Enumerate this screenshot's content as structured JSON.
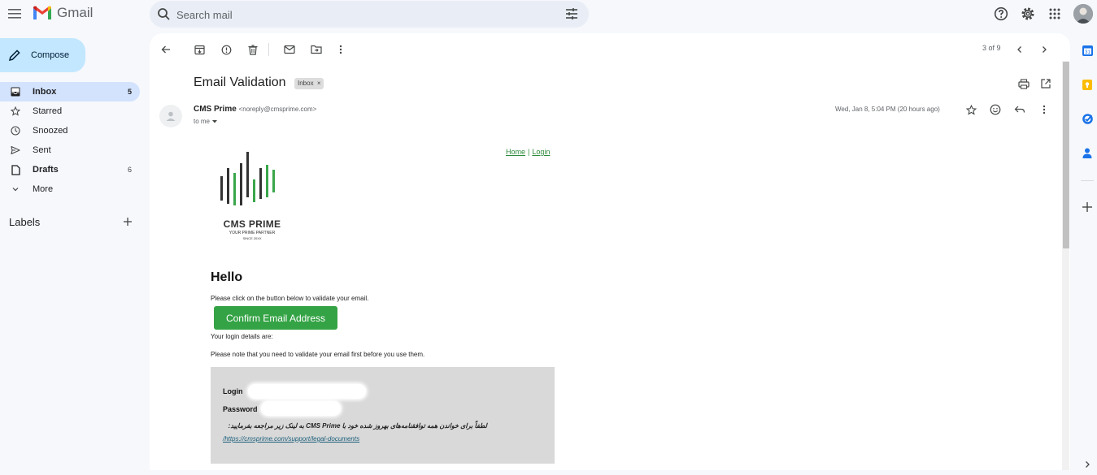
{
  "app": {
    "brand": "Gmail"
  },
  "search": {
    "placeholder": "Search mail"
  },
  "nav": {
    "compose_label": "Compose",
    "items": [
      {
        "label": "Inbox",
        "count": "5",
        "icon": "inbox-icon",
        "active": true
      },
      {
        "label": "Starred",
        "count": "",
        "icon": "star-icon"
      },
      {
        "label": "Snoozed",
        "count": "",
        "icon": "clock-icon"
      },
      {
        "label": "Sent",
        "count": "",
        "icon": "send-icon"
      },
      {
        "label": "Drafts",
        "count": "6",
        "icon": "draft-icon",
        "bold": true
      },
      {
        "label": "More",
        "count": "",
        "icon": "chevron-down-icon"
      }
    ],
    "labels_title": "Labels"
  },
  "toolbar": {
    "pager": "3 of 9"
  },
  "email": {
    "subject": "Email Validation",
    "tag": "Inbox",
    "sender_name": "CMS Prime",
    "sender_addr": "<noreply@cmsprime.com>",
    "to": "to me",
    "date": "Wed, Jan 8, 5:04 PM (20 hours ago)"
  },
  "body": {
    "nav_home": "Home",
    "nav_sep": "|",
    "nav_login": "Login",
    "logo_text": "CMS PRIME",
    "logo_tagline": "YOUR PRIME PARTNER",
    "logo_since": "SINCE 20XX",
    "hello": "Hello",
    "instruction": "Please click on the button below to validate your email.",
    "button": "Confirm Email Address",
    "login_details": "Your login details are:",
    "note": "Please note that you need to validate your email first before you use them.",
    "login_label": "Login",
    "password_label": "Password",
    "farsi_text": "لطفاً برای خواندن همه توافقنامه‌های بهروز شده خود با CMS Prime به لینک زیر مراجعه بفرمایید:",
    "legal_link": "/https://cmsprime.com/support/legal-documents"
  },
  "colors": {
    "accent": "#c2e7ff",
    "active_nav": "#d3e3fd",
    "button_green": "#34a345",
    "link_green": "#2d8a3a"
  }
}
